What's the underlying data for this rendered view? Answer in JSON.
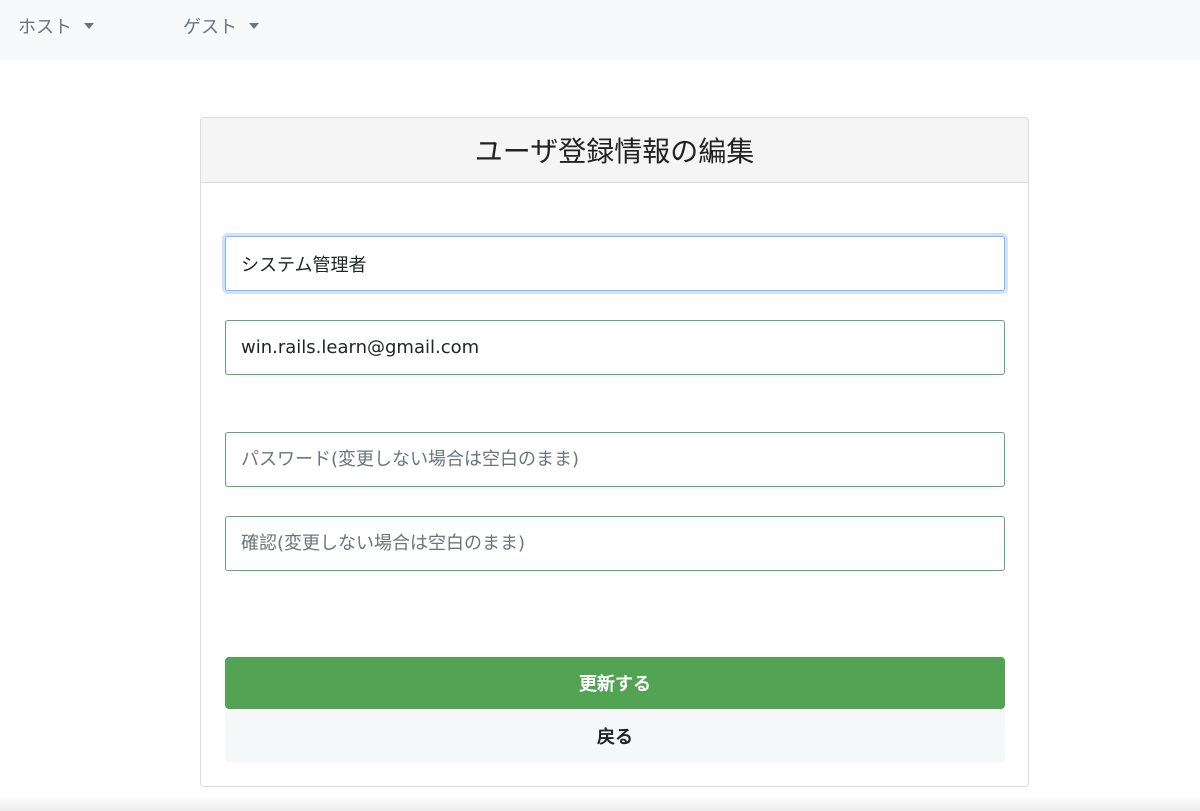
{
  "navbar": {
    "host_label": "ホスト",
    "guest_label": "ゲスト"
  },
  "form": {
    "title": "ユーザ登録情報の編集",
    "name_value": "システム管理者",
    "email_value": "win.rails.learn@gmail.com",
    "password_placeholder": "パスワード(変更しない場合は空白のまま)",
    "confirm_placeholder": "確認(変更しない場合は空白のまま)",
    "submit_label": "更新する",
    "back_label": "戻る"
  },
  "colors": {
    "primary_button": "#52a452",
    "field_border": "#5aa97d",
    "focus_ring": "#80b4ff"
  }
}
